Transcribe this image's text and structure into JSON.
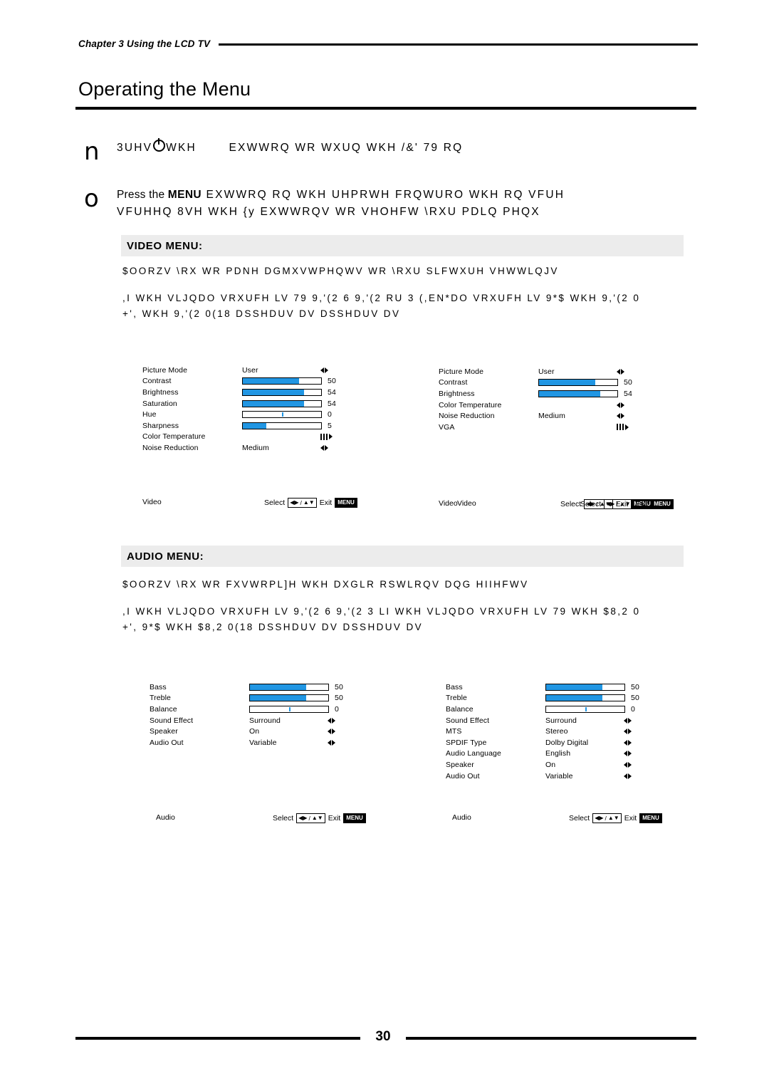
{
  "header": {
    "chapter": "Chapter 3 Using the LCD TV",
    "title": "Operating the Menu"
  },
  "steps": [
    {
      "num": "n",
      "text": "3UHV  WKH        EXWWRQ WR WXUQ WKH /&' 79 RQ"
    },
    {
      "num": "o",
      "lead": "Press the ",
      "keyword": "MENU",
      "text": " EXWWRQ RQ WKH UHPRWH FRQWURO  WKH RQ VFUH",
      "text2": "VFUHHQ  8VH WKH {y EXWWRQV WR VHOHFW \\RXU PDLQ PHQX"
    }
  ],
  "sections": [
    {
      "bar": "VIDEO MENU:",
      "para1": "$OORZV \\RX WR PDNH DGMXVWPHQWV WR \\RXU SLFWXUH VHWWLQJV",
      "para2_line1": ",I WKH VLJQDO VRXUFH LV 79 9,'(2 6 9,'(2 RU 3 (,EN*DO VRXUFH LV 9*$  WKH 9,'(2 0",
      "para2_line1_overlay": "IWKH VLJQDO",
      "para2_line2": "+',  WKH 9,'(2 0(18 DSSHDUV DV  DSSHDUV DV"
    },
    {
      "bar": "AUDIO MENU:",
      "para1": "$OORZV \\RX WR FXVWRPL]H WKH DXGLR RSWLRQV DQG HIIHFWV",
      "para2_line1": ",I WKH VLJQDO VRXUFH LV 9,'(2 6 9,'(2 3  LI WKH VLJQDO VRXUFH LV 79  WKH $8,2 0",
      "para2_line1_overlay": "WKH VLJQDO",
      "para2_line2": "+',  9*$  WKH $8,2 0(18 DSSHDUV DV DSSHDUV DV"
    }
  ],
  "osd": {
    "video_left": {
      "rows": [
        {
          "label": "Picture Mode",
          "value": "User",
          "type": "arrows"
        },
        {
          "label": "Contrast",
          "type": "bar",
          "fill": 72,
          "num": "50"
        },
        {
          "label": "Brightness",
          "type": "bar",
          "fill": 78,
          "num": "54"
        },
        {
          "label": "Saturation",
          "type": "bar",
          "fill": 78,
          "num": "54"
        },
        {
          "label": "Hue",
          "type": "bar-tick",
          "tick": 50,
          "num": "0"
        },
        {
          "label": "Sharpness",
          "type": "bar",
          "fill": 30,
          "num": "5"
        },
        {
          "label": "Color Temperature",
          "type": "bars3"
        },
        {
          "label": "Noise Reduction",
          "value": "Medium",
          "type": "arrows"
        }
      ],
      "footer_left": "Video",
      "footer_select": "Select",
      "footer_exit": "Exit",
      "footer_menu": "MENU"
    },
    "video_right": {
      "rows": [
        {
          "label": "Picture Mode",
          "value": "User",
          "type": "arrows"
        },
        {
          "label": "Contrast",
          "type": "bar",
          "fill": 72,
          "num": "50"
        },
        {
          "label": "Brightness",
          "type": "bar",
          "fill": 78,
          "num": "54"
        },
        {
          "label": "Color Temperature",
          "type": "arrows"
        },
        {
          "label": "Noise Reduction",
          "value": "Medium",
          "type": "arrows"
        },
        {
          "label": "VGA",
          "type": "bars3"
        }
      ],
      "footer_left": "Video",
      "footer_left_dup": "Video",
      "footer_select": "Select",
      "footer_exit": "Exit",
      "footer_menu": "MENU"
    },
    "audio_left": {
      "rows": [
        {
          "label": "Bass",
          "type": "bar",
          "fill": 72,
          "num": "50"
        },
        {
          "label": "Treble",
          "type": "bar",
          "fill": 72,
          "num": "50"
        },
        {
          "label": "Balance",
          "type": "bar-tick",
          "tick": 50,
          "num": "0"
        },
        {
          "label": "Sound Effect",
          "value": "Surround",
          "type": "arrows"
        },
        {
          "label": "Speaker",
          "value": "On",
          "type": "arrows"
        },
        {
          "label": "Audio Out",
          "value": "Variable",
          "type": "arrows"
        }
      ],
      "footer_left": "Audio",
      "footer_select": "Select",
      "footer_exit": "Exit",
      "footer_menu": "MENU"
    },
    "audio_right": {
      "rows": [
        {
          "label": "Bass",
          "type": "bar",
          "fill": 72,
          "num": "50"
        },
        {
          "label": "Treble",
          "type": "bar",
          "fill": 72,
          "num": "50"
        },
        {
          "label": "Balance",
          "type": "bar-tick",
          "tick": 50,
          "num": "0"
        },
        {
          "label": "Sound Effect",
          "value": "Surround",
          "type": "arrows"
        },
        {
          "label": "MTS",
          "value": "Stereo",
          "type": "arrows"
        },
        {
          "label": "SPDIF Type",
          "value": "Dolby Digital",
          "type": "arrows"
        },
        {
          "label": "Audio Language",
          "value": "English",
          "type": "arrows"
        },
        {
          "label": "Speaker",
          "value": "On",
          "type": "arrows"
        },
        {
          "label": "Audio Out",
          "value": "Variable",
          "type": "arrows"
        }
      ],
      "footer_left": "Audio",
      "footer_select": "Select",
      "footer_exit": "Exit",
      "footer_menu": "MENU"
    }
  },
  "footer": {
    "page_number": "30"
  },
  "colors": {
    "bar_fill": "#2196e3",
    "section_bg": "#ececec"
  }
}
